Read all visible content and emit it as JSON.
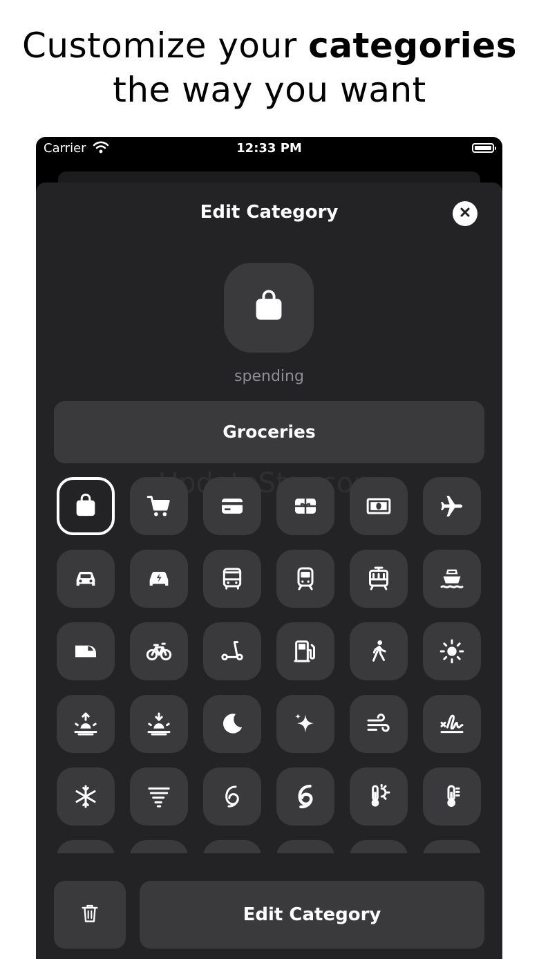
{
  "headline": {
    "line1_prefix": "Customize your ",
    "line1_bold": "categories",
    "line2": "the way you want"
  },
  "status_bar": {
    "carrier": "Carrier",
    "time": "12:33 PM"
  },
  "sheet": {
    "title": "Edit Category",
    "close_icon": "xmark-circle-icon",
    "preview_icon": "bag-icon",
    "category_type": "spending",
    "name_value": "Groceries",
    "watermark": "UpdateStar.com"
  },
  "icons": [
    {
      "name": "bag-icon",
      "selected": true
    },
    {
      "name": "cart-icon"
    },
    {
      "name": "creditcard-icon"
    },
    {
      "name": "giftcard-icon"
    },
    {
      "name": "banknote-icon"
    },
    {
      "name": "airplane-icon"
    },
    {
      "name": "car-icon"
    },
    {
      "name": "electric-car-icon"
    },
    {
      "name": "bus-icon"
    },
    {
      "name": "tram-icon"
    },
    {
      "name": "cablecar-tram-icon"
    },
    {
      "name": "ferry-icon"
    },
    {
      "name": "bullet-train-icon"
    },
    {
      "name": "bicycle-icon"
    },
    {
      "name": "scooter-icon"
    },
    {
      "name": "fuelpump-icon"
    },
    {
      "name": "walking-figure-icon"
    },
    {
      "name": "sun-icon"
    },
    {
      "name": "sunrise-icon"
    },
    {
      "name": "sunset-icon"
    },
    {
      "name": "moon-icon"
    },
    {
      "name": "sparkles-icon"
    },
    {
      "name": "wind-icon"
    },
    {
      "name": "signature-icon"
    },
    {
      "name": "snowflake-icon"
    },
    {
      "name": "tornado-icon"
    },
    {
      "name": "tropical-storm-icon"
    },
    {
      "name": "hurricane-icon"
    },
    {
      "name": "thermometer-sun-icon"
    },
    {
      "name": "thermometer-icon"
    },
    {
      "name": "more-icon"
    },
    {
      "name": "more-icon"
    },
    {
      "name": "more-icon"
    },
    {
      "name": "more-icon"
    },
    {
      "name": "more-icon"
    },
    {
      "name": "more-icon"
    }
  ],
  "footer": {
    "delete_icon": "trash-icon",
    "primary_label": "Edit Category"
  }
}
